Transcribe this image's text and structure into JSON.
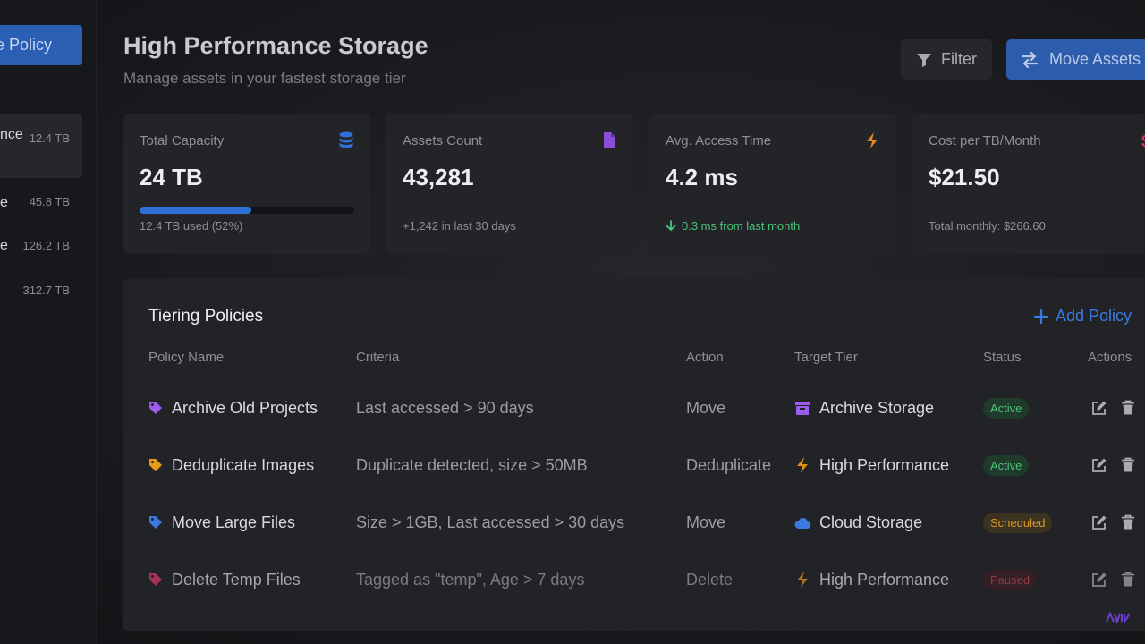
{
  "sidebar": {
    "policy_button_label": "e Policy",
    "tiers": [
      {
        "name": "nce",
        "size": "12.4 TB"
      },
      {
        "name": "e",
        "size": "45.8 TB"
      },
      {
        "name": "e",
        "size": "126.2 TB"
      },
      {
        "name": "",
        "size": "312.7 TB"
      }
    ]
  },
  "header": {
    "title": "High Performance Storage",
    "subtitle": "Manage assets in your fastest storage tier",
    "filter_label": "Filter",
    "move_label": "Move Assets"
  },
  "stats": [
    {
      "label": "Total Capacity",
      "value": "24 TB",
      "footer": "12.4 TB used (52%)",
      "progress": 0.52,
      "icon": "database-icon",
      "color": "#2f6fd8"
    },
    {
      "label": "Assets Count",
      "value": "43,281",
      "footer": "+1,242 in last 30 days",
      "icon": "file-icon",
      "color": "#8a4fd6"
    },
    {
      "label": "Avg. Access Time",
      "value": "4.2 ms",
      "footer": "0.3 ms from last month",
      "icon": "bolt-icon",
      "color": "#e08a1c"
    },
    {
      "label": "Cost per TB/Month",
      "value": "$21.50",
      "footer": "Total monthly: $266.60",
      "icon": "dollar-icon",
      "color": "#d0386a"
    }
  ],
  "policies": {
    "title": "Tiering Policies",
    "add_label": "Add Policy",
    "columns": [
      "Policy Name",
      "Criteria",
      "Action",
      "Target Tier",
      "Status",
      "Actions"
    ],
    "rows": [
      {
        "name": "Archive Old Projects",
        "tag_color": "#9b5cf0",
        "criteria": "Last accessed > 90 days",
        "action": "Move",
        "tier": "Archive Storage",
        "tier_icon": "archive-icon",
        "status": "Active",
        "status_kind": "active"
      },
      {
        "name": "Deduplicate Images",
        "tag_color": "#e89a1f",
        "criteria": "Duplicate detected, size > 50MB",
        "action": "Deduplicate",
        "tier": "High Performance",
        "tier_icon": "bolt-icon",
        "status": "Active",
        "status_kind": "active"
      },
      {
        "name": "Move Large Files",
        "tag_color": "#3a7ae0",
        "criteria": "Size > 1GB, Last accessed > 30 days",
        "action": "Move",
        "tier": "Cloud Storage",
        "tier_icon": "cloud-icon",
        "status": "Scheduled",
        "status_kind": "scheduled"
      },
      {
        "name": "Delete Temp Files",
        "tag_color": "#d23a6b",
        "criteria": "Tagged as \"temp\", Age > 7 days",
        "action": "Delete",
        "tier": "High Performance",
        "tier_icon": "bolt-icon",
        "status": "Paused",
        "status_kind": "paused"
      }
    ]
  }
}
